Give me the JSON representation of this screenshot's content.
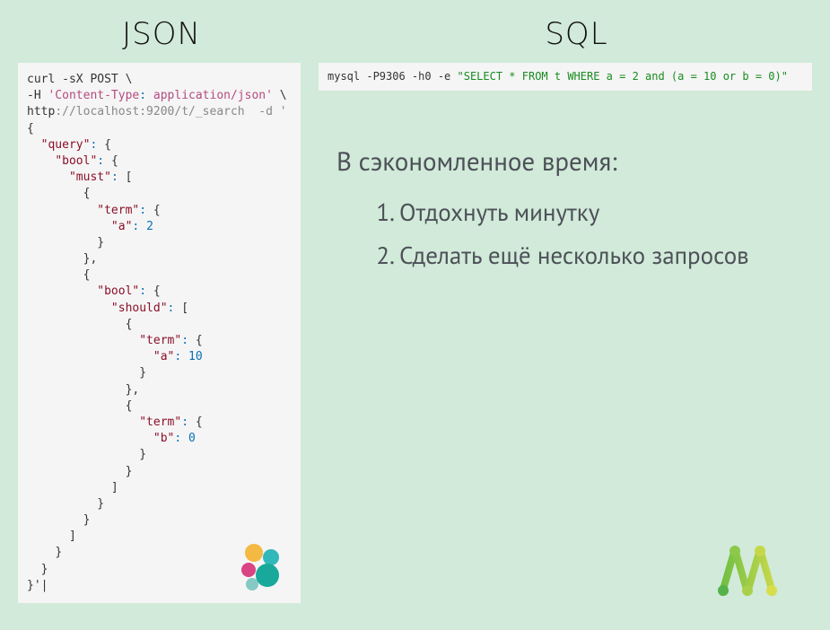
{
  "headers": {
    "left": "JSON",
    "right": "SQL"
  },
  "json_code": {
    "l1": "curl -sX POST \\",
    "l2a": "-H ",
    "l2b": "'Content-Type",
    "l2c": ":",
    "l2d": " application/json'",
    "l2e": " \\",
    "l3a": "http",
    "l3b": "://localhost:9200/t/_search  -d '",
    "k_query": "\"query\"",
    "k_bool": "\"bool\"",
    "k_must": "\"must\"",
    "k_term": "\"term\"",
    "k_a": "\"a\"",
    "k_b": "\"b\"",
    "k_should": "\"should\"",
    "v2": "2",
    "v10": "10",
    "v0": "0",
    "colon": ":",
    "ob": "{",
    "cb": "}",
    "osb": "[",
    "csb": "]",
    "comma": ",",
    "tail": "}'",
    "cursor": "|"
  },
  "sql_code": {
    "prefix": "mysql -P9306 -h0 -e ",
    "query": "\"SELECT * FROM t WHERE a = 2 and (a = 10 or b = 0)\""
  },
  "saved": {
    "title": "В сэкономленное время:",
    "items": [
      "Отдохнуть минутку",
      "Сделать ещё несколько запросов"
    ]
  },
  "icons": {
    "elastic": "elastic-logo",
    "manticore": "manticore-logo"
  }
}
